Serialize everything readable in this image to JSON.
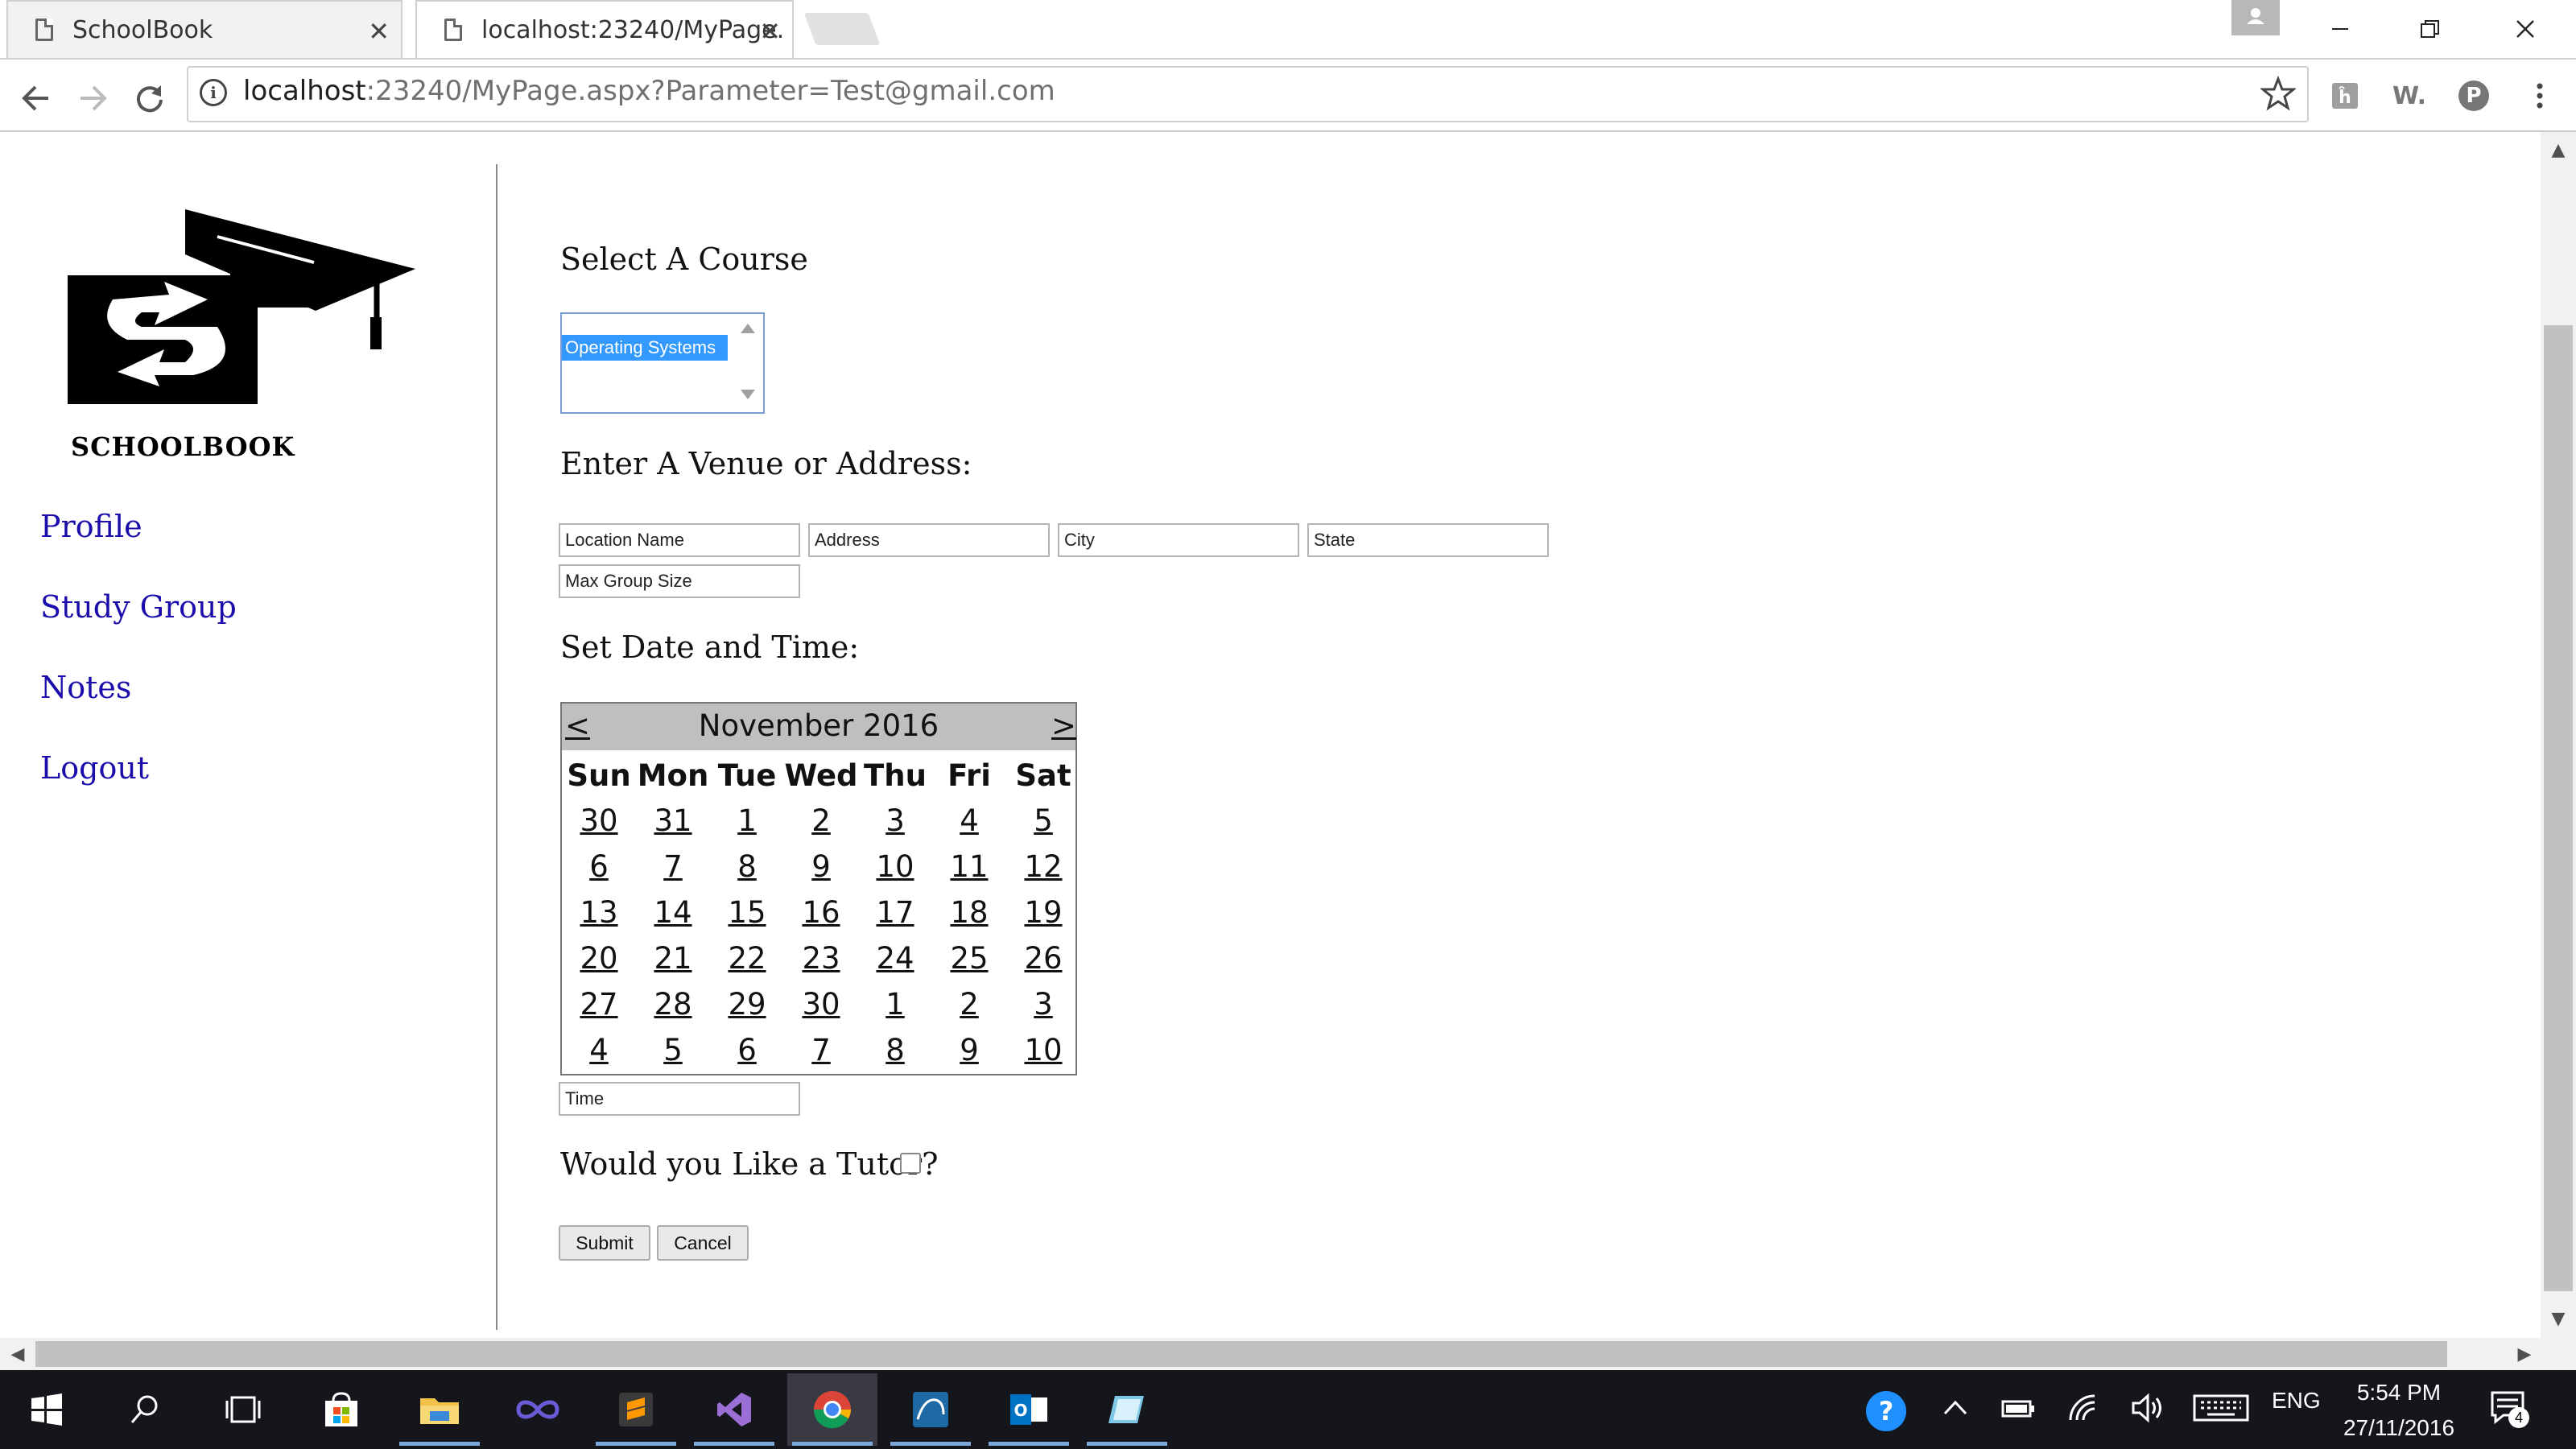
{
  "browser": {
    "tabs": [
      {
        "title": "SchoolBook"
      },
      {
        "title": "localhost:23240/MyPage."
      }
    ],
    "url": {
      "host": "localhost",
      "rest": ":23240/MyPage.aspx?Parameter=Test@gmail.com"
    },
    "extensions": [
      "W.",
      "P"
    ]
  },
  "sidebar": {
    "logo_text": "SCHOOLBOOK",
    "links": [
      {
        "label": "Profile"
      },
      {
        "label": "Study Group"
      },
      {
        "label": "Notes"
      },
      {
        "label": "Logout"
      }
    ]
  },
  "form": {
    "course_heading": "Select A Course",
    "course_selected": "Operating Systems",
    "venue_heading": "Enter A Venue or Address:",
    "fields": {
      "location": "Location Name",
      "address": "Address",
      "city": "City",
      "state": "State",
      "max_group": "Max Group Size",
      "time": "Time"
    },
    "date_heading": "Set Date and Time:",
    "tutor_label": "Would you Like a Tutor?",
    "tutor_checked": false,
    "submit_label": "Submit",
    "cancel_label": "Cancel"
  },
  "calendar": {
    "title": "November 2016",
    "prev": "<",
    "next": ">",
    "days_of_week": [
      "Sun",
      "Mon",
      "Tue",
      "Wed",
      "Thu",
      "Fri",
      "Sat"
    ],
    "weeks": [
      [
        "30",
        "31",
        "1",
        "2",
        "3",
        "4",
        "5"
      ],
      [
        "6",
        "7",
        "8",
        "9",
        "10",
        "11",
        "12"
      ],
      [
        "13",
        "14",
        "15",
        "16",
        "17",
        "18",
        "19"
      ],
      [
        "20",
        "21",
        "22",
        "23",
        "24",
        "25",
        "26"
      ],
      [
        "27",
        "28",
        "29",
        "30",
        "1",
        "2",
        "3"
      ],
      [
        "4",
        "5",
        "6",
        "7",
        "8",
        "9",
        "10"
      ]
    ]
  },
  "taskbar": {
    "language": "ENG",
    "time": "5:54 PM",
    "date": "27/11/2016",
    "notifications": "4"
  },
  "colors": {
    "link": "#1a0dab",
    "selection": "#3399ff",
    "calendar_header": "#bfbfbf",
    "taskbar": "#15151c"
  }
}
